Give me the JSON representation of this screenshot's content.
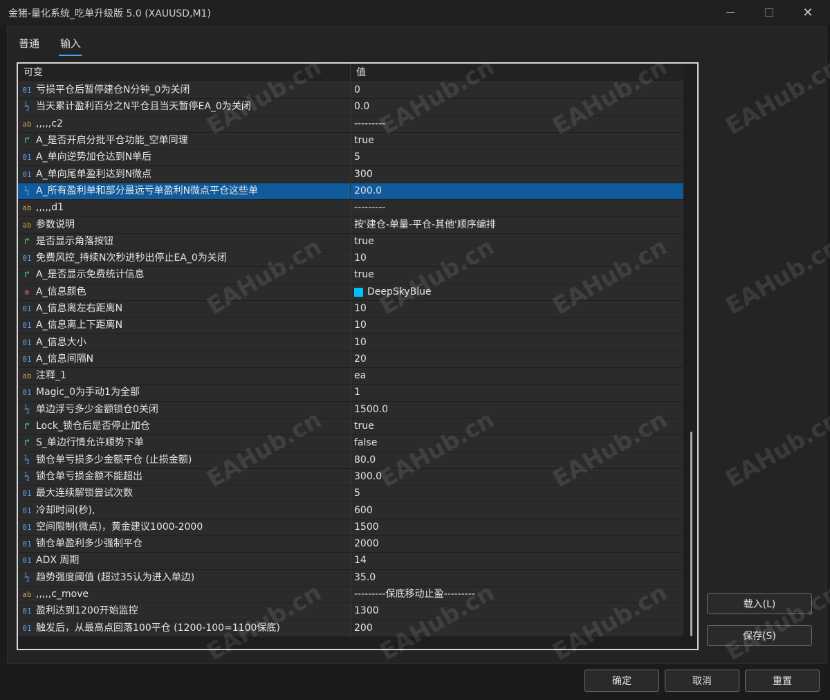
{
  "window": {
    "title": "金猪-量化系统_吃单升级版 5.0 (XAUUSD,M1)"
  },
  "tabs": [
    {
      "label": "普通",
      "active": false
    },
    {
      "label": "输入",
      "active": true
    }
  ],
  "grid": {
    "col_name": "可变",
    "col_value": "值",
    "rows": [
      {
        "type": "int",
        "icon": "01",
        "name": "亏损平仓后暂停建仓N分钟_0为关闭",
        "value": "0"
      },
      {
        "type": "dbl",
        "icon": "½",
        "name": "当天累计盈利百分之N平仓且当天暂停EA_0为关闭",
        "value": "0.0"
      },
      {
        "type": "str",
        "icon": "ab",
        "name": ",,,,,c2",
        "value": "---------"
      },
      {
        "type": "bool",
        "icon": "↱",
        "name": "A_是否开启分批平仓功能_空单同理",
        "value": "true"
      },
      {
        "type": "int",
        "icon": "01",
        "name": "A_单向逆势加仓达到N单后",
        "value": "5"
      },
      {
        "type": "int",
        "icon": "01",
        "name": "A_单向尾单盈利达到N微点",
        "value": "300"
      },
      {
        "type": "dbl",
        "icon": "½",
        "name": "A_所有盈利单和部分最远亏单盈利N微点平仓这些单",
        "value": "200.0",
        "selected": true
      },
      {
        "type": "str",
        "icon": "ab",
        "name": ",,,,,d1",
        "value": "---------"
      },
      {
        "type": "str",
        "icon": "ab",
        "name": "参数说明",
        "value": "按'建仓-单量-平仓-其他'顺序编排"
      },
      {
        "type": "bool",
        "icon": "↱",
        "name": "是否显示角落按钮",
        "value": "true"
      },
      {
        "type": "int",
        "icon": "01",
        "name": "免费风控_持续N次秒进秒出停止EA_0为关闭",
        "value": "10"
      },
      {
        "type": "bool",
        "icon": "↱",
        "name": "A_是否显示免费统计信息",
        "value": "true"
      },
      {
        "type": "clr",
        "icon": "❁",
        "name": "A_信息颜色",
        "value": "DeepSkyBlue",
        "swatch": "#00bfff"
      },
      {
        "type": "int",
        "icon": "01",
        "name": "A_信息离左右距离N",
        "value": "10"
      },
      {
        "type": "int",
        "icon": "01",
        "name": "A_信息离上下距离N",
        "value": "10"
      },
      {
        "type": "int",
        "icon": "01",
        "name": "A_信息大小",
        "value": "10"
      },
      {
        "type": "int",
        "icon": "01",
        "name": "A_信息间隔N",
        "value": "20"
      },
      {
        "type": "str",
        "icon": "ab",
        "name": "注释_1",
        "value": "ea"
      },
      {
        "type": "int",
        "icon": "01",
        "name": "Magic_0为手动1为全部",
        "value": "1"
      },
      {
        "type": "dbl",
        "icon": "½",
        "name": "单边浮亏多少金额锁仓0关闭",
        "value": "1500.0"
      },
      {
        "type": "bool",
        "icon": "↱",
        "name": "Lock_锁仓后是否停止加仓",
        "value": "true"
      },
      {
        "type": "bool",
        "icon": "↱",
        "name": "S_单边行情允许顺势下单",
        "value": "false"
      },
      {
        "type": "dbl",
        "icon": "½",
        "name": "锁仓单亏损多少金额平仓 (止损金额)",
        "value": "80.0"
      },
      {
        "type": "dbl",
        "icon": "½",
        "name": "锁仓单亏损金额不能超出",
        "value": "300.0"
      },
      {
        "type": "int",
        "icon": "01",
        "name": "最大连续解锁尝试次数",
        "value": "5"
      },
      {
        "type": "int",
        "icon": "01",
        "name": "冷却时间(秒),",
        "value": "600"
      },
      {
        "type": "int",
        "icon": "01",
        "name": "空间限制(微点)，黄金建议1000-2000",
        "value": "1500"
      },
      {
        "type": "int",
        "icon": "01",
        "name": "锁仓单盈利多少强制平仓",
        "value": "2000"
      },
      {
        "type": "int",
        "icon": "01",
        "name": "ADX 周期",
        "value": "14"
      },
      {
        "type": "dbl",
        "icon": "½",
        "name": "趋势强度阈值 (超过35认为进入单边)",
        "value": "35.0"
      },
      {
        "type": "str",
        "icon": "ab",
        "name": ",,,,,c_move",
        "value": "---------保底移动止盈---------"
      },
      {
        "type": "int",
        "icon": "01",
        "name": "盈利达到1200开始监控",
        "value": "1300"
      },
      {
        "type": "int",
        "icon": "01",
        "name": "触发后，从最高点回落100平仓 (1200-100=1100保底)",
        "value": "200"
      }
    ]
  },
  "buttons": {
    "load": "载入(L)",
    "save": "保存(S)",
    "ok": "确定",
    "cancel": "取消",
    "reset": "重置"
  },
  "watermark": "EAHub.cn"
}
